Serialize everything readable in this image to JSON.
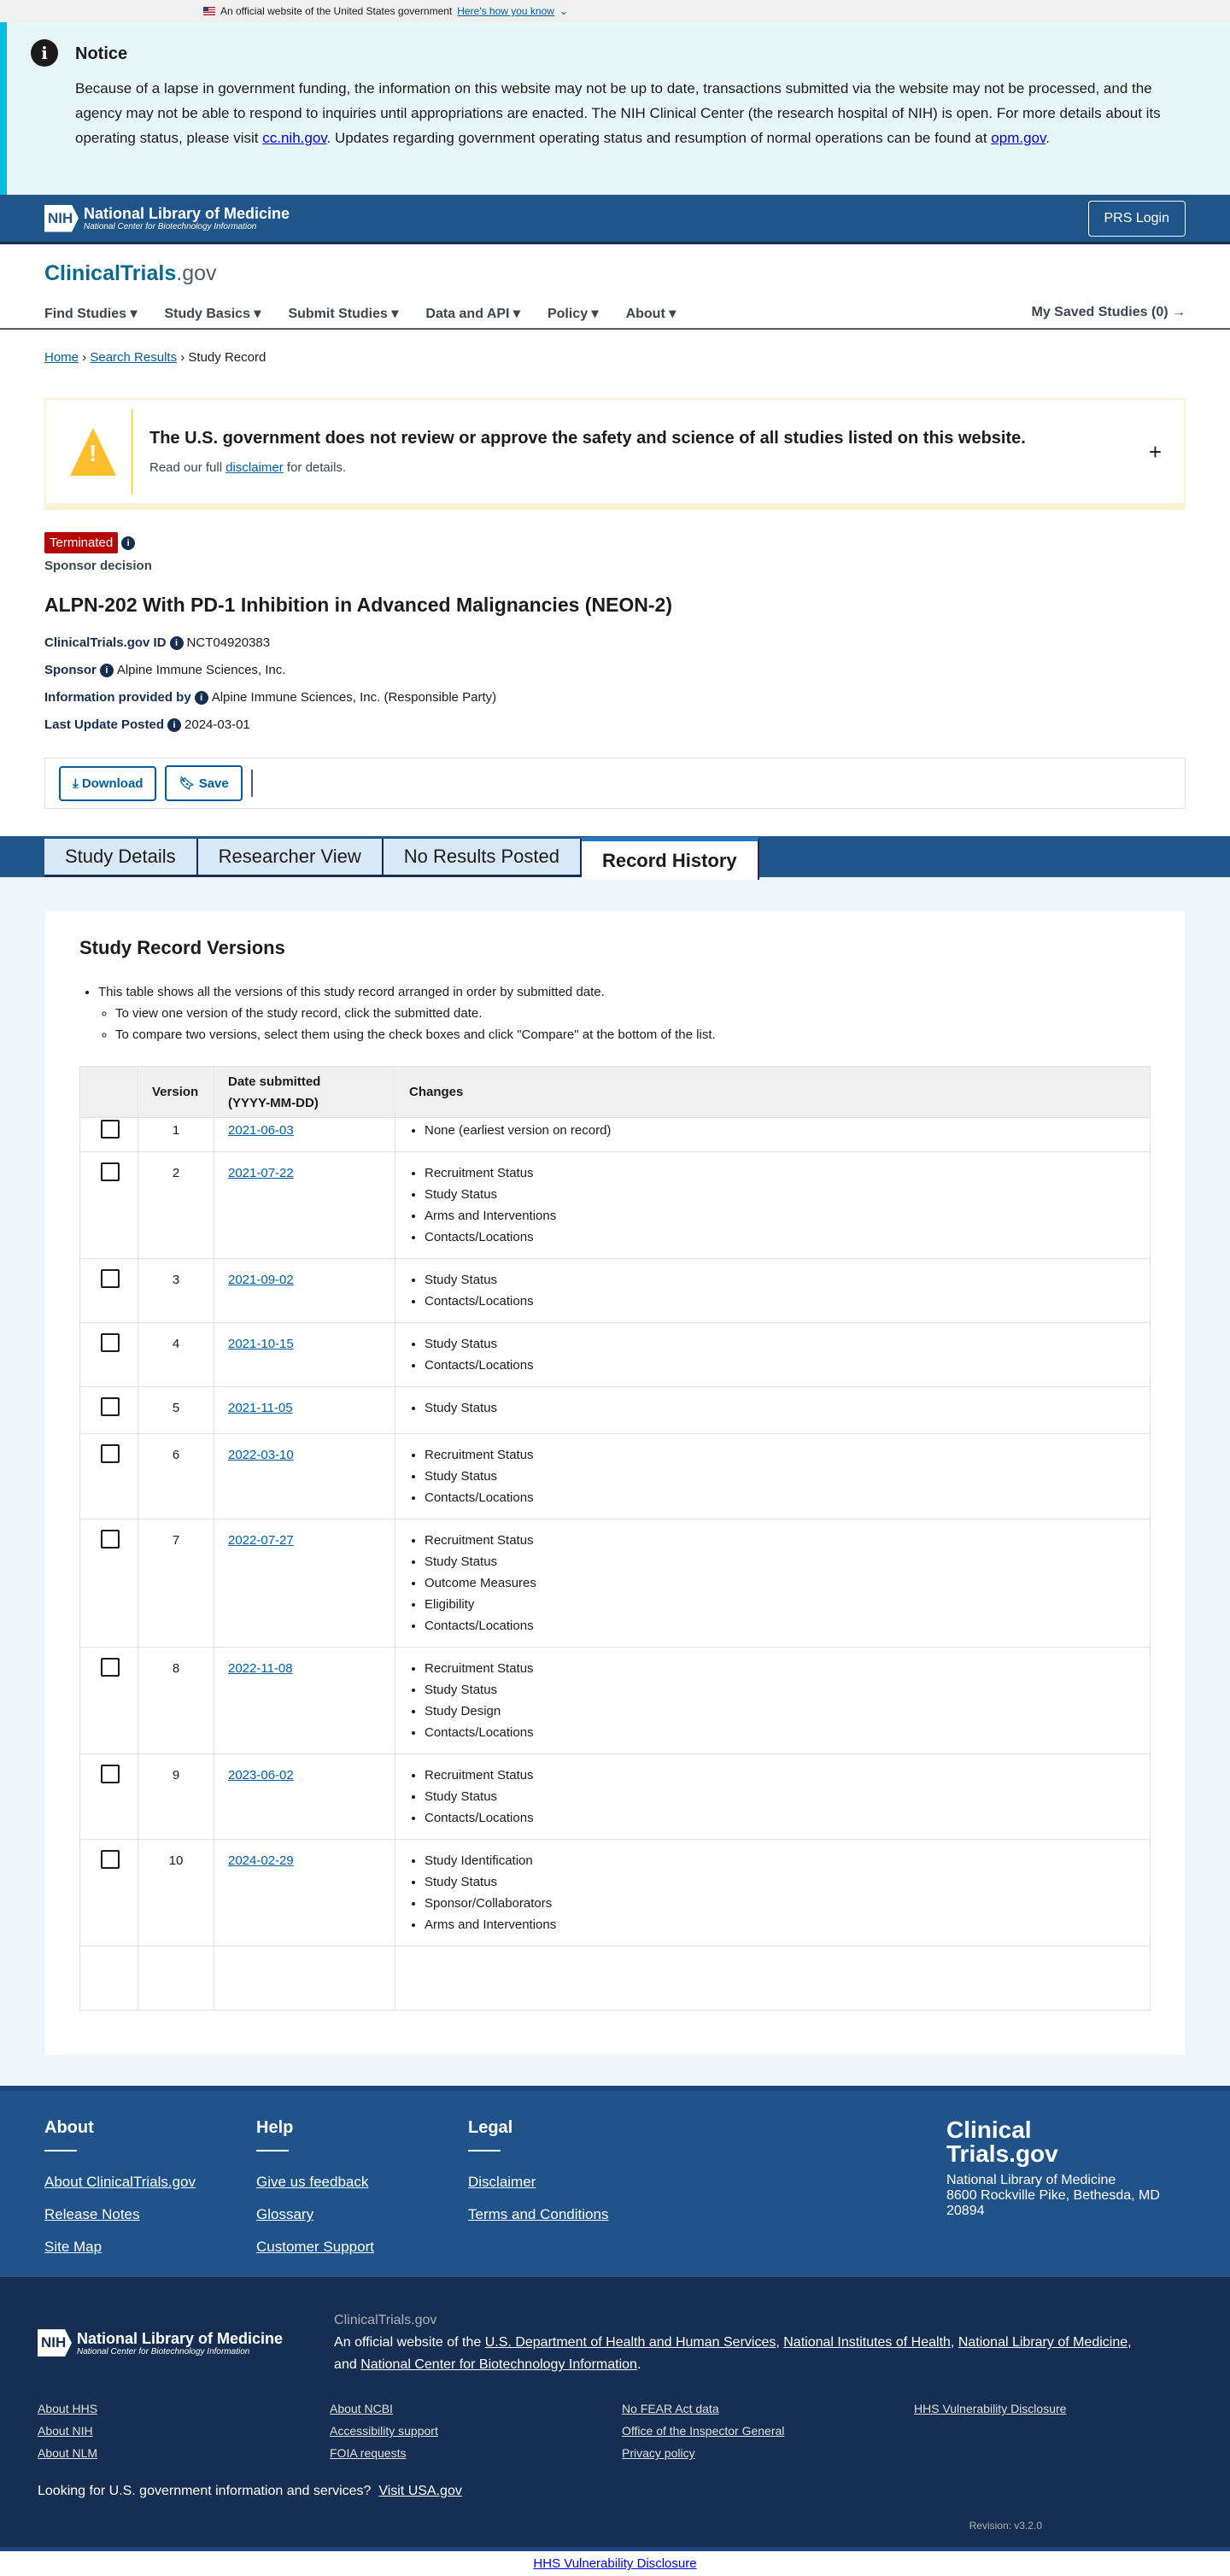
{
  "gov_banner": {
    "text": "An official website of the United States government",
    "link": "Here's how you know"
  },
  "notice": {
    "title": "Notice",
    "text1": "Because of a lapse in government funding, the information on this website may not be up to date, transactions submitted via the website may not be processed, and the agency may not be able to respond to inquiries until appropriations are enacted. The NIH Clinical Center (the research hospital of NIH) is open. For more details about its operating status, please visit ",
    "link1": "cc.nih.gov",
    "text2": ". Updates regarding government operating status and resumption of normal operations can be found at ",
    "link2": "opm.gov",
    "text3": "."
  },
  "header": {
    "nih": "NIH",
    "nlm": "National Library of Medicine",
    "ncbi": "National Center for Biotechnology Information",
    "prs": "PRS Login"
  },
  "brand": {
    "main": "ClinicalTrials",
    "suffix": ".gov"
  },
  "nav": {
    "items": [
      "Find Studies ▾",
      "Study Basics ▾",
      "Submit Studies ▾",
      "Data and API ▾",
      "Policy ▾",
      "About ▾"
    ],
    "saved": "My Saved Studies (0) →"
  },
  "breadcrumb": {
    "home": "Home",
    "search": "Search Results",
    "current": "Study Record"
  },
  "disclaimer": {
    "title": "The U.S. government does not review or approve the safety and science of all studies listed on this website.",
    "pre": "Read our full ",
    "link": "disclaimer",
    "post": " for details.",
    "expand": "+"
  },
  "study": {
    "status": "Terminated",
    "reason": "Sponsor decision",
    "title": "ALPN-202 With PD-1 Inhibition in Advanced Malignancies (NEON-2)",
    "fields": [
      {
        "k": "ClinicalTrials.gov ID",
        "v": "NCT04920383"
      },
      {
        "k": "Sponsor",
        "v": "Alpine Immune Sciences, Inc."
      },
      {
        "k": "Information provided by",
        "v": "Alpine Immune Sciences, Inc. (Responsible Party)"
      },
      {
        "k": "Last Update Posted",
        "v": "2024-03-01"
      }
    ]
  },
  "actions": {
    "download": "Download",
    "save": "Save"
  },
  "tabs": [
    "Study Details",
    "Researcher View",
    "No Results Posted",
    "Record History"
  ],
  "history": {
    "title": "Study Record Versions",
    "intro": "This table shows all the versions of this study record arranged in order by submitted date.",
    "sub1": "To view one version of the study record, click the submitted date.",
    "sub2": "To compare two versions, select them using the check boxes and click \"Compare\" at the bottom of the list.",
    "headers": {
      "version": "Version",
      "date1": "Date submitted",
      "date2": "(YYYY-MM-DD)",
      "changes": "Changes"
    },
    "rows": [
      {
        "version": "1",
        "date": "2021-06-03",
        "changes": [
          "None (earliest version on record)"
        ]
      },
      {
        "version": "2",
        "date": "2021-07-22",
        "changes": [
          "Recruitment Status",
          "Study Status",
          "Arms and Interventions",
          "Contacts/Locations"
        ]
      },
      {
        "version": "3",
        "date": "2021-09-02",
        "changes": [
          "Study Status",
          "Contacts/Locations"
        ]
      },
      {
        "version": "4",
        "date": "2021-10-15",
        "changes": [
          "Study Status",
          "Contacts/Locations"
        ]
      },
      {
        "version": "5",
        "date": "2021-11-05",
        "changes": [
          "Study Status"
        ]
      },
      {
        "version": "6",
        "date": "2022-03-10",
        "changes": [
          "Recruitment Status",
          "Study Status",
          "Contacts/Locations"
        ]
      },
      {
        "version": "7",
        "date": "2022-07-27",
        "changes": [
          "Recruitment Status",
          "Study Status",
          "Outcome Measures",
          "Eligibility",
          "Contacts/Locations"
        ]
      },
      {
        "version": "8",
        "date": "2022-11-08",
        "changes": [
          "Recruitment Status",
          "Study Status",
          "Study Design",
          "Contacts/Locations"
        ]
      },
      {
        "version": "9",
        "date": "2023-06-02",
        "changes": [
          "Recruitment Status",
          "Study Status",
          "Contacts/Locations"
        ]
      },
      {
        "version": "10",
        "date": "2024-02-29",
        "changes": [
          "Study Identification",
          "Study Status",
          "Sponsor/Collaborators",
          "Arms and Interventions"
        ]
      }
    ]
  },
  "footer": {
    "cols": [
      {
        "h": "About",
        "links": [
          "About ClinicalTrials.gov",
          "Release Notes",
          "Site Map"
        ]
      },
      {
        "h": "Help",
        "links": [
          "Give us feedback",
          "Glossary",
          "Customer Support"
        ]
      },
      {
        "h": "Legal",
        "links": [
          "Disclaimer",
          "Terms and Conditions"
        ]
      }
    ],
    "brand1": "Clinical",
    "brand2": "Trials.gov",
    "addr1": "National Library of Medicine",
    "addr2": "8600 Rockville Pike, Bethesda, MD",
    "addr3": "20894",
    "site": "ClinicalTrials.gov",
    "official_pre": "An official website of the ",
    "hhs": "U.S. Department of Health and Human Services",
    "nih": "National Institutes of Health",
    "nlm": "National Library of Medicine",
    "and": "and ",
    "ncbi": "National Center for Biotechnology Information",
    "links": [
      "About HHS",
      "About NCBI",
      "No FEAR Act data",
      "HHS Vulnerability Disclosure",
      "About NIH",
      "Accessibility support",
      "Office of the Inspector General",
      "",
      "About NLM",
      "FOIA requests",
      "Privacy policy",
      ""
    ],
    "usa_text": "Looking for U.S. government information and services?",
    "usa_link": "Visit USA.gov",
    "revision": "Revision: v3.2.0",
    "bottom": "HHS Vulnerability Disclosure"
  }
}
